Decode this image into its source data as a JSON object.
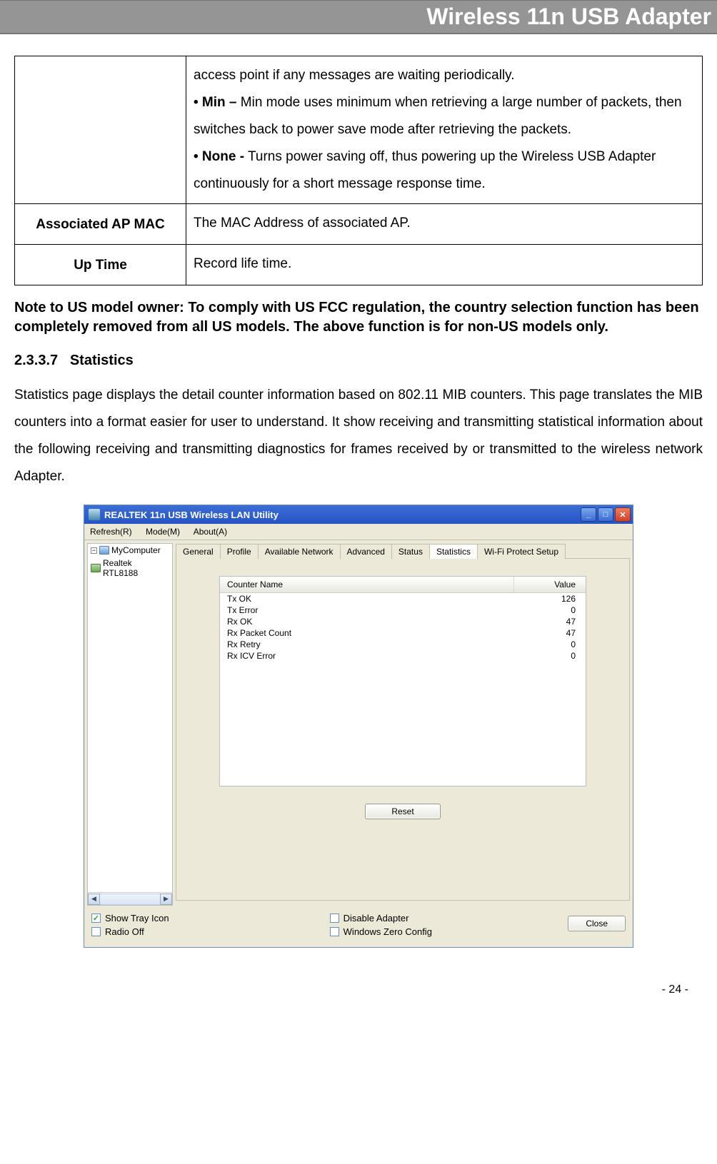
{
  "header": "Wireless 11n USB Adapter",
  "table": {
    "row0_desc_part1": "access point if any messages are waiting periodically.",
    "row0_bold1": "• Min –",
    "row0_text1": " Min mode uses minimum when retrieving a large number of packets, then switches back to power save mode after retrieving the packets.",
    "row0_bold2": "• None -",
    "row0_text2": " Turns power saving off, thus powering up the Wireless USB Adapter continuously for a short message response time.",
    "row1_term": "Associated AP MAC",
    "row1_desc": "The MAC Address of associated AP.",
    "row2_term": "Up Time",
    "row2_desc": "Record life time."
  },
  "note": "Note to US model owner: To comply with US FCC regulation, the country selection function has been completely removed from all US models. The above function is for non-US models only.",
  "section_num": "2.3.3.7",
  "section_title": "Statistics",
  "para": "Statistics page displays the detail counter information based on 802.11 MIB counters. This page translates the MIB counters into a format easier for user to understand. It show receiving and transmitting statistical information about the following receiving and transmitting diagnostics for frames received by or transmitted to the wireless network Adapter.",
  "app": {
    "title": "REALTEK 11n USB Wireless LAN Utility",
    "menus": {
      "m1": "Refresh(R)",
      "m2": "Mode(M)",
      "m3": "About(A)"
    },
    "tree": {
      "root": "MyComputer",
      "child": "Realtek RTL8188"
    },
    "tabs": {
      "t1": "General",
      "t2": "Profile",
      "t3": "Available Network",
      "t4": "Advanced",
      "t5": "Status",
      "t6": "Statistics",
      "t7": "Wi-Fi Protect Setup"
    },
    "stats_header": {
      "name": "Counter Name",
      "value": "Value"
    },
    "stats": [
      {
        "name": "Tx OK",
        "value": "126"
      },
      {
        "name": "Tx Error",
        "value": "0"
      },
      {
        "name": "Rx OK",
        "value": "47"
      },
      {
        "name": "Rx Packet Count",
        "value": "47"
      },
      {
        "name": "Rx Retry",
        "value": "0"
      },
      {
        "name": "Rx ICV Error",
        "value": "0"
      }
    ],
    "reset": "Reset",
    "cb_show_tray": "Show Tray Icon",
    "cb_radio_off": "Radio Off",
    "cb_disable_adapter": "Disable Adapter",
    "cb_wzc": "Windows Zero Config",
    "close": "Close"
  },
  "page_num": "- 24 -"
}
